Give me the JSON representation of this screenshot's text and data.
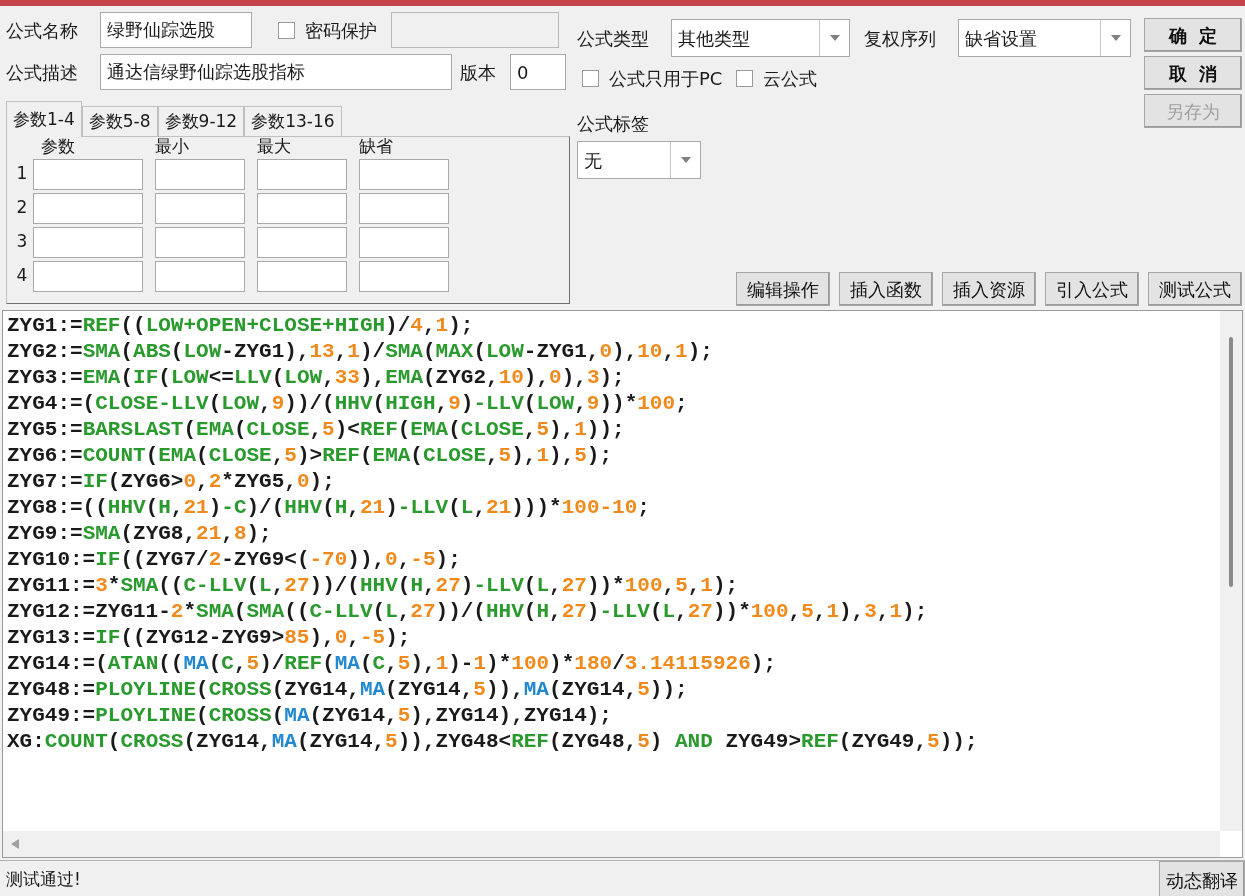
{
  "name_field": {
    "label": "公式名称",
    "value": "绿野仙踪选股"
  },
  "password": {
    "label": "密码保护",
    "checked": false
  },
  "description_field": {
    "label": "公式描述",
    "value": "通达信绿野仙踪选股指标"
  },
  "version_field": {
    "label": "版本",
    "value": "0"
  },
  "formula_type": {
    "label": "公式类型",
    "value": "其他类型"
  },
  "rights_sequence": {
    "label": "复权序列",
    "value": "缺省设置"
  },
  "options": [
    {
      "label": "公式只用于PC",
      "checked": false
    },
    {
      "label": "云公式",
      "checked": false
    }
  ],
  "formula_tag": {
    "label": "公式标签",
    "value": "无"
  },
  "dialog_buttons": [
    {
      "label": "确  定",
      "disabled": false
    },
    {
      "label": "取  消",
      "disabled": false
    },
    {
      "label": "另存为",
      "disabled": true
    }
  ],
  "tabs": [
    {
      "label": "参数1-4",
      "selected": true
    },
    {
      "label": "参数5-8",
      "selected": false
    },
    {
      "label": "参数9-12",
      "selected": false
    },
    {
      "label": "参数13-16",
      "selected": false
    }
  ],
  "params": {
    "columns": [
      "参数",
      "最小",
      "最大",
      "缺省"
    ],
    "rows": [
      "1",
      "2",
      "3",
      "4"
    ]
  },
  "action_buttons": [
    "编辑操作",
    "插入函数",
    "插入资源",
    "引入公式",
    "测试公式"
  ],
  "code_lines": [
    [
      {
        "kind": "plain",
        "text": "ZYG1:="
      },
      {
        "kind": "fn",
        "text": "REF"
      },
      {
        "kind": "plain",
        "text": "(("
      },
      {
        "kind": "fn",
        "text": "LOW+OPEN+CLOSE+HIGH"
      },
      {
        "kind": "plain",
        "text": ")/"
      },
      {
        "kind": "num",
        "text": "4"
      },
      {
        "kind": "plain",
        "text": ","
      },
      {
        "kind": "num",
        "text": "1"
      },
      {
        "kind": "plain",
        "text": ");"
      }
    ],
    [
      {
        "kind": "plain",
        "text": "ZYG2:="
      },
      {
        "kind": "fn",
        "text": "SMA"
      },
      {
        "kind": "plain",
        "text": "("
      },
      {
        "kind": "fn",
        "text": "ABS"
      },
      {
        "kind": "plain",
        "text": "("
      },
      {
        "kind": "fn",
        "text": "LOW"
      },
      {
        "kind": "plain",
        "text": "-ZYG1),"
      },
      {
        "kind": "num",
        "text": "13"
      },
      {
        "kind": "plain",
        "text": ","
      },
      {
        "kind": "num",
        "text": "1"
      },
      {
        "kind": "plain",
        "text": ")/"
      },
      {
        "kind": "fn",
        "text": "SMA"
      },
      {
        "kind": "plain",
        "text": "("
      },
      {
        "kind": "fn",
        "text": "MAX"
      },
      {
        "kind": "plain",
        "text": "("
      },
      {
        "kind": "fn",
        "text": "LOW"
      },
      {
        "kind": "plain",
        "text": "-ZYG1,"
      },
      {
        "kind": "num",
        "text": "0"
      },
      {
        "kind": "plain",
        "text": "),"
      },
      {
        "kind": "num",
        "text": "10"
      },
      {
        "kind": "plain",
        "text": ","
      },
      {
        "kind": "num",
        "text": "1"
      },
      {
        "kind": "plain",
        "text": ");"
      }
    ],
    [
      {
        "kind": "plain",
        "text": "ZYG3:="
      },
      {
        "kind": "fn",
        "text": "EMA"
      },
      {
        "kind": "plain",
        "text": "("
      },
      {
        "kind": "fn",
        "text": "IF"
      },
      {
        "kind": "plain",
        "text": "("
      },
      {
        "kind": "fn",
        "text": "LOW"
      },
      {
        "kind": "plain",
        "text": "<="
      },
      {
        "kind": "fn",
        "text": "LLV"
      },
      {
        "kind": "plain",
        "text": "("
      },
      {
        "kind": "fn",
        "text": "LOW"
      },
      {
        "kind": "plain",
        "text": ","
      },
      {
        "kind": "num",
        "text": "33"
      },
      {
        "kind": "plain",
        "text": "),"
      },
      {
        "kind": "fn",
        "text": "EMA"
      },
      {
        "kind": "plain",
        "text": "(ZYG2,"
      },
      {
        "kind": "num",
        "text": "10"
      },
      {
        "kind": "plain",
        "text": "),"
      },
      {
        "kind": "num",
        "text": "0"
      },
      {
        "kind": "plain",
        "text": "),"
      },
      {
        "kind": "num",
        "text": "3"
      },
      {
        "kind": "plain",
        "text": ");"
      }
    ],
    [
      {
        "kind": "plain",
        "text": "ZYG4:=("
      },
      {
        "kind": "fn",
        "text": "CLOSE-LLV"
      },
      {
        "kind": "plain",
        "text": "("
      },
      {
        "kind": "fn",
        "text": "LOW"
      },
      {
        "kind": "plain",
        "text": ","
      },
      {
        "kind": "num",
        "text": "9"
      },
      {
        "kind": "plain",
        "text": "))/("
      },
      {
        "kind": "fn",
        "text": "HHV"
      },
      {
        "kind": "plain",
        "text": "("
      },
      {
        "kind": "fn",
        "text": "HIGH"
      },
      {
        "kind": "plain",
        "text": ","
      },
      {
        "kind": "num",
        "text": "9"
      },
      {
        "kind": "plain",
        "text": ")"
      },
      {
        "kind": "fn",
        "text": "-LLV"
      },
      {
        "kind": "plain",
        "text": "("
      },
      {
        "kind": "fn",
        "text": "LOW"
      },
      {
        "kind": "plain",
        "text": ","
      },
      {
        "kind": "num",
        "text": "9"
      },
      {
        "kind": "plain",
        "text": "))*"
      },
      {
        "kind": "num",
        "text": "100"
      },
      {
        "kind": "plain",
        "text": ";"
      }
    ],
    [
      {
        "kind": "plain",
        "text": "ZYG5:="
      },
      {
        "kind": "fn",
        "text": "BARSLAST"
      },
      {
        "kind": "plain",
        "text": "("
      },
      {
        "kind": "fn",
        "text": "EMA"
      },
      {
        "kind": "plain",
        "text": "("
      },
      {
        "kind": "fn",
        "text": "CLOSE"
      },
      {
        "kind": "plain",
        "text": ","
      },
      {
        "kind": "num",
        "text": "5"
      },
      {
        "kind": "plain",
        "text": ")<"
      },
      {
        "kind": "fn",
        "text": "REF"
      },
      {
        "kind": "plain",
        "text": "("
      },
      {
        "kind": "fn",
        "text": "EMA"
      },
      {
        "kind": "plain",
        "text": "("
      },
      {
        "kind": "fn",
        "text": "CLOSE"
      },
      {
        "kind": "plain",
        "text": ","
      },
      {
        "kind": "num",
        "text": "5"
      },
      {
        "kind": "plain",
        "text": "),"
      },
      {
        "kind": "num",
        "text": "1"
      },
      {
        "kind": "plain",
        "text": "));"
      }
    ],
    [
      {
        "kind": "plain",
        "text": "ZYG6:="
      },
      {
        "kind": "fn",
        "text": "COUNT"
      },
      {
        "kind": "plain",
        "text": "("
      },
      {
        "kind": "fn",
        "text": "EMA"
      },
      {
        "kind": "plain",
        "text": "("
      },
      {
        "kind": "fn",
        "text": "CLOSE"
      },
      {
        "kind": "plain",
        "text": ","
      },
      {
        "kind": "num",
        "text": "5"
      },
      {
        "kind": "plain",
        "text": ")>"
      },
      {
        "kind": "fn",
        "text": "REF"
      },
      {
        "kind": "plain",
        "text": "("
      },
      {
        "kind": "fn",
        "text": "EMA"
      },
      {
        "kind": "plain",
        "text": "("
      },
      {
        "kind": "fn",
        "text": "CLOSE"
      },
      {
        "kind": "plain",
        "text": ","
      },
      {
        "kind": "num",
        "text": "5"
      },
      {
        "kind": "plain",
        "text": "),"
      },
      {
        "kind": "num",
        "text": "1"
      },
      {
        "kind": "plain",
        "text": "),"
      },
      {
        "kind": "num",
        "text": "5"
      },
      {
        "kind": "plain",
        "text": ");"
      }
    ],
    [
      {
        "kind": "plain",
        "text": "ZYG7:="
      },
      {
        "kind": "fn",
        "text": "IF"
      },
      {
        "kind": "plain",
        "text": "(ZYG6>"
      },
      {
        "kind": "num",
        "text": "0"
      },
      {
        "kind": "plain",
        "text": ","
      },
      {
        "kind": "num",
        "text": "2"
      },
      {
        "kind": "plain",
        "text": "*ZYG5,"
      },
      {
        "kind": "num",
        "text": "0"
      },
      {
        "kind": "plain",
        "text": ");"
      }
    ],
    [
      {
        "kind": "plain",
        "text": "ZYG8:=(("
      },
      {
        "kind": "fn",
        "text": "HHV"
      },
      {
        "kind": "plain",
        "text": "("
      },
      {
        "kind": "fn",
        "text": "H"
      },
      {
        "kind": "plain",
        "text": ","
      },
      {
        "kind": "num",
        "text": "21"
      },
      {
        "kind": "plain",
        "text": ")"
      },
      {
        "kind": "fn",
        "text": "-C"
      },
      {
        "kind": "plain",
        "text": ")/("
      },
      {
        "kind": "fn",
        "text": "HHV"
      },
      {
        "kind": "plain",
        "text": "("
      },
      {
        "kind": "fn",
        "text": "H"
      },
      {
        "kind": "plain",
        "text": ","
      },
      {
        "kind": "num",
        "text": "21"
      },
      {
        "kind": "plain",
        "text": ")"
      },
      {
        "kind": "fn",
        "text": "-LLV"
      },
      {
        "kind": "plain",
        "text": "("
      },
      {
        "kind": "fn",
        "text": "L"
      },
      {
        "kind": "plain",
        "text": ","
      },
      {
        "kind": "num",
        "text": "21"
      },
      {
        "kind": "plain",
        "text": ")))*"
      },
      {
        "kind": "num",
        "text": "100-10"
      },
      {
        "kind": "plain",
        "text": ";"
      }
    ],
    [
      {
        "kind": "plain",
        "text": "ZYG9:="
      },
      {
        "kind": "fn",
        "text": "SMA"
      },
      {
        "kind": "plain",
        "text": "(ZYG8,"
      },
      {
        "kind": "num",
        "text": "21"
      },
      {
        "kind": "plain",
        "text": ","
      },
      {
        "kind": "num",
        "text": "8"
      },
      {
        "kind": "plain",
        "text": ");"
      }
    ],
    [
      {
        "kind": "plain",
        "text": "ZYG10:="
      },
      {
        "kind": "fn",
        "text": "IF"
      },
      {
        "kind": "plain",
        "text": "((ZYG7/"
      },
      {
        "kind": "num",
        "text": "2"
      },
      {
        "kind": "plain",
        "text": "-ZYG9<("
      },
      {
        "kind": "num",
        "text": "-70"
      },
      {
        "kind": "plain",
        "text": ")),"
      },
      {
        "kind": "num",
        "text": "0"
      },
      {
        "kind": "plain",
        "text": ","
      },
      {
        "kind": "num",
        "text": "-5"
      },
      {
        "kind": "plain",
        "text": ");"
      }
    ],
    [
      {
        "kind": "plain",
        "text": "ZYG11:="
      },
      {
        "kind": "num",
        "text": "3"
      },
      {
        "kind": "plain",
        "text": "*"
      },
      {
        "kind": "fn",
        "text": "SMA"
      },
      {
        "kind": "plain",
        "text": "(("
      },
      {
        "kind": "fn",
        "text": "C-LLV"
      },
      {
        "kind": "plain",
        "text": "("
      },
      {
        "kind": "fn",
        "text": "L"
      },
      {
        "kind": "plain",
        "text": ","
      },
      {
        "kind": "num",
        "text": "27"
      },
      {
        "kind": "plain",
        "text": "))/("
      },
      {
        "kind": "fn",
        "text": "HHV"
      },
      {
        "kind": "plain",
        "text": "("
      },
      {
        "kind": "fn",
        "text": "H"
      },
      {
        "kind": "plain",
        "text": ","
      },
      {
        "kind": "num",
        "text": "27"
      },
      {
        "kind": "plain",
        "text": ")"
      },
      {
        "kind": "fn",
        "text": "-LLV"
      },
      {
        "kind": "plain",
        "text": "("
      },
      {
        "kind": "fn",
        "text": "L"
      },
      {
        "kind": "plain",
        "text": ","
      },
      {
        "kind": "num",
        "text": "27"
      },
      {
        "kind": "plain",
        "text": "))*"
      },
      {
        "kind": "num",
        "text": "100"
      },
      {
        "kind": "plain",
        "text": ","
      },
      {
        "kind": "num",
        "text": "5"
      },
      {
        "kind": "plain",
        "text": ","
      },
      {
        "kind": "num",
        "text": "1"
      },
      {
        "kind": "plain",
        "text": ");"
      }
    ],
    [
      {
        "kind": "plain",
        "text": "ZYG12:=ZYG11-"
      },
      {
        "kind": "num",
        "text": "2"
      },
      {
        "kind": "plain",
        "text": "*"
      },
      {
        "kind": "fn",
        "text": "SMA"
      },
      {
        "kind": "plain",
        "text": "("
      },
      {
        "kind": "fn",
        "text": "SMA"
      },
      {
        "kind": "plain",
        "text": "(("
      },
      {
        "kind": "fn",
        "text": "C-LLV"
      },
      {
        "kind": "plain",
        "text": "("
      },
      {
        "kind": "fn",
        "text": "L"
      },
      {
        "kind": "plain",
        "text": ","
      },
      {
        "kind": "num",
        "text": "27"
      },
      {
        "kind": "plain",
        "text": "))/("
      },
      {
        "kind": "fn",
        "text": "HHV"
      },
      {
        "kind": "plain",
        "text": "("
      },
      {
        "kind": "fn",
        "text": "H"
      },
      {
        "kind": "plain",
        "text": ","
      },
      {
        "kind": "num",
        "text": "27"
      },
      {
        "kind": "plain",
        "text": ")"
      },
      {
        "kind": "fn",
        "text": "-LLV"
      },
      {
        "kind": "plain",
        "text": "("
      },
      {
        "kind": "fn",
        "text": "L"
      },
      {
        "kind": "plain",
        "text": ","
      },
      {
        "kind": "num",
        "text": "27"
      },
      {
        "kind": "plain",
        "text": "))*"
      },
      {
        "kind": "num",
        "text": "100"
      },
      {
        "kind": "plain",
        "text": ","
      },
      {
        "kind": "num",
        "text": "5"
      },
      {
        "kind": "plain",
        "text": ","
      },
      {
        "kind": "num",
        "text": "1"
      },
      {
        "kind": "plain",
        "text": "),"
      },
      {
        "kind": "num",
        "text": "3"
      },
      {
        "kind": "plain",
        "text": ","
      },
      {
        "kind": "num",
        "text": "1"
      },
      {
        "kind": "plain",
        "text": ");"
      }
    ],
    [
      {
        "kind": "plain",
        "text": "ZYG13:="
      },
      {
        "kind": "fn",
        "text": "IF"
      },
      {
        "kind": "plain",
        "text": "((ZYG12-ZYG9>"
      },
      {
        "kind": "num",
        "text": "85"
      },
      {
        "kind": "plain",
        "text": "),"
      },
      {
        "kind": "num",
        "text": "0"
      },
      {
        "kind": "plain",
        "text": ","
      },
      {
        "kind": "num",
        "text": "-5"
      },
      {
        "kind": "plain",
        "text": ");"
      }
    ],
    [
      {
        "kind": "plain",
        "text": "ZYG14:=("
      },
      {
        "kind": "fn",
        "text": "ATAN"
      },
      {
        "kind": "plain",
        "text": "(("
      },
      {
        "kind": "ma",
        "text": "MA"
      },
      {
        "kind": "plain",
        "text": "("
      },
      {
        "kind": "fn",
        "text": "C"
      },
      {
        "kind": "plain",
        "text": ","
      },
      {
        "kind": "num",
        "text": "5"
      },
      {
        "kind": "plain",
        "text": ")/"
      },
      {
        "kind": "fn",
        "text": "REF"
      },
      {
        "kind": "plain",
        "text": "("
      },
      {
        "kind": "ma",
        "text": "MA"
      },
      {
        "kind": "plain",
        "text": "("
      },
      {
        "kind": "fn",
        "text": "C"
      },
      {
        "kind": "plain",
        "text": ","
      },
      {
        "kind": "num",
        "text": "5"
      },
      {
        "kind": "plain",
        "text": "),"
      },
      {
        "kind": "num",
        "text": "1"
      },
      {
        "kind": "plain",
        "text": ")-"
      },
      {
        "kind": "num",
        "text": "1"
      },
      {
        "kind": "plain",
        "text": ")*"
      },
      {
        "kind": "num",
        "text": "100"
      },
      {
        "kind": "plain",
        "text": ")*"
      },
      {
        "kind": "num",
        "text": "180"
      },
      {
        "kind": "plain",
        "text": "/"
      },
      {
        "kind": "num",
        "text": "3.14115926"
      },
      {
        "kind": "plain",
        "text": ");"
      }
    ],
    [
      {
        "kind": "plain",
        "text": "ZYG48:="
      },
      {
        "kind": "fn",
        "text": "PLOYLINE"
      },
      {
        "kind": "plain",
        "text": "("
      },
      {
        "kind": "fn",
        "text": "CROSS"
      },
      {
        "kind": "plain",
        "text": "(ZYG14,"
      },
      {
        "kind": "ma",
        "text": "MA"
      },
      {
        "kind": "plain",
        "text": "(ZYG14,"
      },
      {
        "kind": "num",
        "text": "5"
      },
      {
        "kind": "plain",
        "text": ")),"
      },
      {
        "kind": "ma",
        "text": "MA"
      },
      {
        "kind": "plain",
        "text": "(ZYG14,"
      },
      {
        "kind": "num",
        "text": "5"
      },
      {
        "kind": "plain",
        "text": "));"
      }
    ],
    [
      {
        "kind": "plain",
        "text": "ZYG49:="
      },
      {
        "kind": "fn",
        "text": "PLOYLINE"
      },
      {
        "kind": "plain",
        "text": "("
      },
      {
        "kind": "fn",
        "text": "CROSS"
      },
      {
        "kind": "plain",
        "text": "("
      },
      {
        "kind": "ma",
        "text": "MA"
      },
      {
        "kind": "plain",
        "text": "(ZYG14,"
      },
      {
        "kind": "num",
        "text": "5"
      },
      {
        "kind": "plain",
        "text": "),ZYG14),ZYG14);"
      }
    ],
    [
      {
        "kind": "plain",
        "text": "XG:"
      },
      {
        "kind": "fn",
        "text": "COUNT"
      },
      {
        "kind": "plain",
        "text": "("
      },
      {
        "kind": "fn",
        "text": "CROSS"
      },
      {
        "kind": "plain",
        "text": "(ZYG14,"
      },
      {
        "kind": "ma",
        "text": "MA"
      },
      {
        "kind": "plain",
        "text": "(ZYG14,"
      },
      {
        "kind": "num",
        "text": "5"
      },
      {
        "kind": "plain",
        "text": ")),ZYG48<"
      },
      {
        "kind": "fn",
        "text": "REF"
      },
      {
        "kind": "plain",
        "text": "(ZYG48,"
      },
      {
        "kind": "num",
        "text": "5"
      },
      {
        "kind": "plain",
        "text": ") "
      },
      {
        "kind": "fn",
        "text": "AND"
      },
      {
        "kind": "plain",
        "text": " ZYG49>"
      },
      {
        "kind": "fn",
        "text": "REF"
      },
      {
        "kind": "plain",
        "text": "(ZYG49,"
      },
      {
        "kind": "num",
        "text": "5"
      },
      {
        "kind": "plain",
        "text": "));"
      }
    ]
  ],
  "status": {
    "text": "测试通过!"
  },
  "translate_button": "动态翻译"
}
